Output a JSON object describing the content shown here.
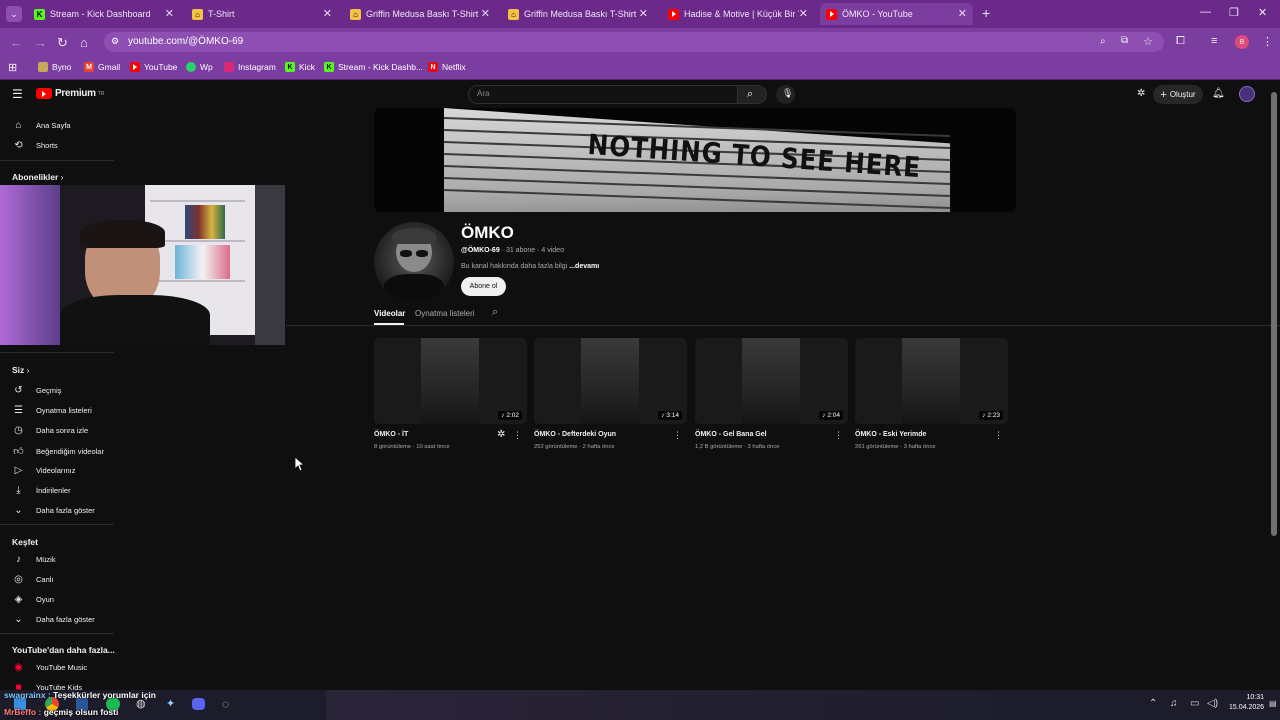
{
  "browser": {
    "tabs": [
      {
        "title": "Stream - Kick Dashboard",
        "icon": "kick-icon"
      },
      {
        "title": "T-Shirt",
        "icon": "tshirt-icon"
      },
      {
        "title": "Griffin Medusa Baskı T-Shirt - B",
        "icon": "tshirt-icon"
      },
      {
        "title": "Griffin Medusa Baskı T-Shirt - S",
        "icon": "tshirt-icon"
      },
      {
        "title": "Hadise & Motive | Küçük Bir Yol",
        "icon": "youtube-icon"
      },
      {
        "title": "ÖMKO - YouTube",
        "icon": "youtube-icon",
        "active": true
      }
    ],
    "url": "youtube.com/@ÖMKO-69",
    "profile_initial": "B",
    "bookmarks": [
      "Byno",
      "Gmail",
      "YouTube",
      "Wp",
      "Instagram",
      "Kick",
      "Stream - Kick Dashb...",
      "Netflix"
    ],
    "accent": "#7c3da0"
  },
  "youtube": {
    "logo": "Premium",
    "logo_sup": "TR",
    "search_placeholder": "Ara",
    "create_label": "Oluştur",
    "sidebar": {
      "top": [
        {
          "label": "Ana Sayfa",
          "icon": "home-icon"
        },
        {
          "label": "Shorts",
          "icon": "shorts-icon"
        }
      ],
      "subs_heading": "Abonelikler",
      "you_heading": "Siz",
      "you": [
        {
          "label": "Geçmiş",
          "icon": "history-icon"
        },
        {
          "label": "Oynatma listeleri",
          "icon": "playlists-icon"
        },
        {
          "label": "Daha sonra izle",
          "icon": "clock-icon"
        },
        {
          "label": "Beğendiğim videolar",
          "icon": "like-icon"
        },
        {
          "label": "Videolarınız",
          "icon": "video-icon"
        },
        {
          "label": "İndirilenler",
          "icon": "download-icon"
        },
        {
          "label": "Daha fazla göster",
          "icon": "chevron-down-icon"
        }
      ],
      "explore_heading": "Keşfet",
      "explore": [
        {
          "label": "Müzik",
          "icon": "music-icon"
        },
        {
          "label": "Canlı",
          "icon": "live-icon"
        },
        {
          "label": "Oyun",
          "icon": "gaming-icon"
        },
        {
          "label": "Daha fazla göster",
          "icon": "chevron-down-icon"
        }
      ],
      "more_heading": "YouTube'dan daha fazla...",
      "more": [
        {
          "label": "YouTube Music",
          "icon": "youtube-music-icon"
        },
        {
          "label": "YouTube Kids",
          "icon": "youtube-kids-icon"
        }
      ]
    },
    "channel": {
      "banner_text": "NOTHING TO SEE HERE",
      "name": "ÖMKO",
      "handle": "@ÖMKO-69",
      "subs": "31 abone",
      "videos": "4 video",
      "desc": "Bu kanal hakkında daha fazla bilgi",
      "desc_more": "...devamı",
      "subscribe_label": "Abone ol",
      "tabs": [
        "Videolar",
        "Oynatma listeleri"
      ]
    },
    "videos": [
      {
        "title": "ÖMKO - İT",
        "views": "8 görüntüleme",
        "age": "10 saat önce",
        "duration": "2:02"
      },
      {
        "title": "ÖMKO - Defterdeki Oyun",
        "views": "252 görüntüleme",
        "age": "2 hafta önce",
        "duration": "3:14"
      },
      {
        "title": "ÖMKO - Gel Bana Gel",
        "views": "1,2 B görüntüleme",
        "age": "3 hafta önce",
        "duration": "2:04"
      },
      {
        "title": "ÖMKO - Eski Yerimde",
        "views": "261 görüntüleme",
        "age": "3 hafta önce",
        "duration": "2:23"
      }
    ]
  },
  "stream": {
    "chat_line1_user": "swagrainx :",
    "chat_line1_msg": "Teşekkürler yorumlar için",
    "chat_line2_user": "MrBeffo :",
    "chat_line2_msg": "geçmiş olsun fosti"
  },
  "taskbar": {
    "time": "10:31",
    "date": "15.04.2026"
  }
}
